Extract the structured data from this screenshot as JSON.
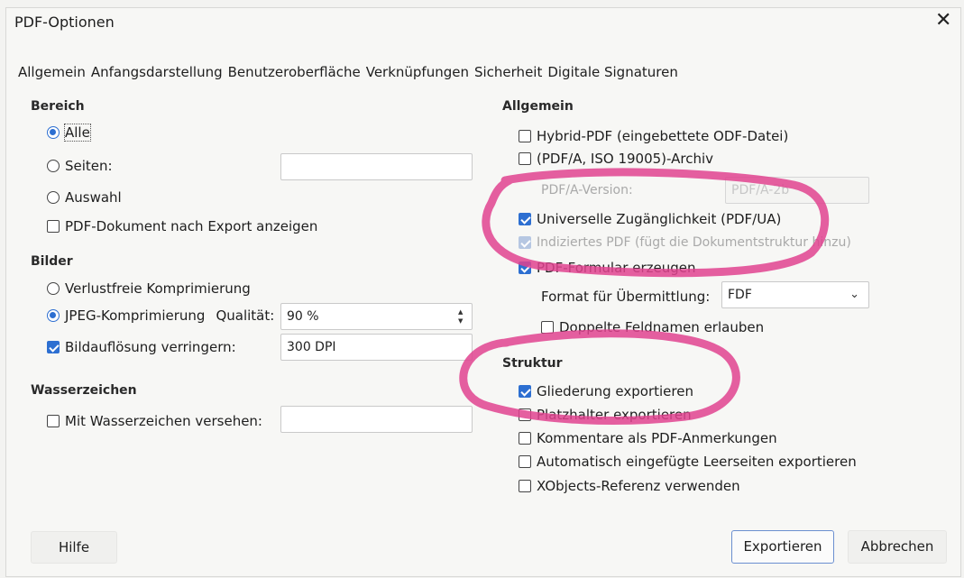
{
  "dialog": {
    "title": "PDF-Optionen",
    "close_icon": "close-icon"
  },
  "tabs": [
    "Allgemein",
    "Anfangsdarstellung",
    "Benutzeroberfläche",
    "Verknüpfungen",
    "Sicherheit",
    "Digitale Signaturen"
  ],
  "left": {
    "range": {
      "heading": "Bereich",
      "all": "Alle",
      "pages": "Seiten:",
      "pages_value": "",
      "selection": "Auswahl",
      "show_after_export": "PDF-Dokument nach Export anzeigen"
    },
    "images": {
      "heading": "Bilder",
      "lossless": "Verlustfreie Komprimierung",
      "jpeg": "JPEG-Komprimierung",
      "quality_label": "Qualität:",
      "quality_value": "90 %",
      "reduce_resolution": "Bildauflösung verringern:",
      "resolution_value": "300 DPI"
    },
    "watermark": {
      "heading": "Wasserzeichen",
      "with_watermark": "Mit Wasserzeichen versehen:",
      "watermark_value": ""
    }
  },
  "right": {
    "general": {
      "heading": "Allgemein",
      "hybrid_pdf": "Hybrid-PDF (eingebettete ODF-Datei)",
      "pdfa_archive": "(PDF/A, ISO 19005)-Archiv",
      "pdfa_version_label": "PDF/A-Version:",
      "pdfa_version_value": "PDF/A-2b",
      "universal_access": "Universelle Zugänglichkeit (PDF/UA)",
      "tagged_pdf": "Indiziertes PDF (fügt die Dokumentstruktur hinzu)",
      "create_form": "PDF-Formular erzeugen",
      "submit_format_label": "Format für Übermittlung:",
      "submit_format_value": "FDF",
      "allow_duplicate_names": "Doppelte Feldnamen erlauben"
    },
    "structure": {
      "heading": "Struktur",
      "export_outlines": "Gliederung exportieren",
      "export_placeholders": "Platzhalter exportieren",
      "comments_as_annotations": "Kommentare als PDF-Anmerkungen",
      "export_blank_pages": "Automatisch eingefügte Leerseiten exportieren",
      "xobjects_reference": "XObjects-Referenz verwenden"
    }
  },
  "buttons": {
    "help": "Hilfe",
    "export": "Exportieren",
    "cancel": "Abbrechen"
  },
  "colors": {
    "accent": "#2d6fd1",
    "highlighter": "#e0438f"
  }
}
